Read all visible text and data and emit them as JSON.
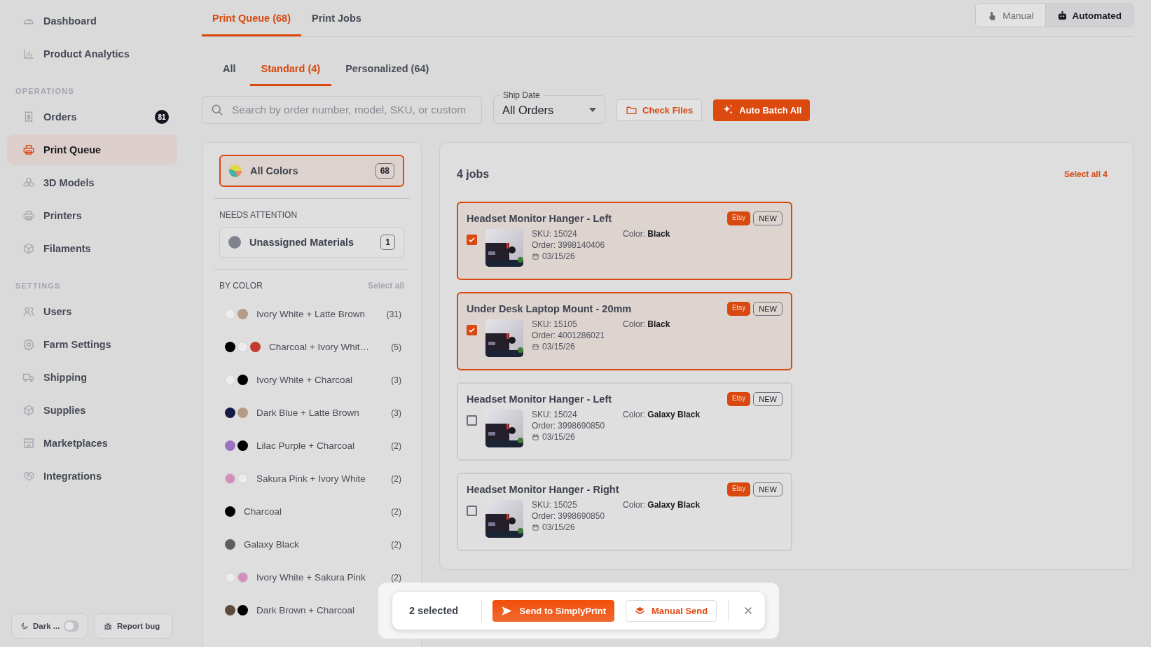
{
  "sidebar": {
    "sections": [
      {
        "items": [
          {
            "label": "Dashboard",
            "selected": false
          },
          {
            "label": "Product Analytics",
            "selected": false
          }
        ]
      },
      {
        "title": "OPERATIONS",
        "items": [
          {
            "label": "Orders",
            "selected": false,
            "badge": "81"
          },
          {
            "label": "Print Queue",
            "selected": true
          },
          {
            "label": "3D Models",
            "selected": false
          },
          {
            "label": "Printers",
            "selected": false
          },
          {
            "label": "Filaments",
            "selected": false
          }
        ]
      },
      {
        "title": "SETTINGS",
        "items": [
          {
            "label": "Users",
            "selected": false
          },
          {
            "label": "Farm Settings",
            "selected": false
          },
          {
            "label": "Shipping",
            "selected": false
          },
          {
            "label": "Supplies",
            "selected": false
          },
          {
            "label": "Marketplaces",
            "selected": false
          },
          {
            "label": "Integrations",
            "selected": false
          }
        ]
      }
    ],
    "dark_mode": {
      "label": "Dark ...",
      "on": false
    },
    "report_bug": "Report bug"
  },
  "tabs": [
    {
      "label": "Print Queue (68)",
      "selected": true
    },
    {
      "label": "Print Jobs",
      "selected": false
    }
  ],
  "mode_switch": [
    {
      "label": "Manual",
      "selected": false
    },
    {
      "label": "Automated",
      "selected": true
    }
  ],
  "subtabs": [
    {
      "label": "All",
      "selected": false
    },
    {
      "label": "Standard (4)",
      "selected": true
    },
    {
      "label": "Personalized (64)",
      "selected": false
    }
  ],
  "filters": {
    "search": {
      "placeholder": "Search by order number, model, SKU, or custom"
    },
    "ship_date": {
      "label": "Ship Date",
      "value": "All Orders"
    },
    "check_files": "Check Files",
    "auto_batch": "Auto Batch All"
  },
  "color_panel": {
    "all_colors": {
      "label": "All Colors",
      "count": "68",
      "selected": true
    },
    "needs_attention": {
      "title": "NEEDS ATTENTION",
      "items": [
        {
          "label": "Unassigned Materials",
          "count": "1",
          "selected": false
        }
      ]
    },
    "by_color": {
      "title": "BY COLOR",
      "select_all": "Select all",
      "items": [
        {
          "label": "Ivory White + Latte Brown",
          "count": "(31)",
          "swatches": [
            {
              "color": "#ececec"
            },
            {
              "color": "#b59c87"
            }
          ]
        },
        {
          "label": "Charcoal + Ivory Whit…",
          "count": "(5)",
          "swatches": [
            {
              "color": "#000000"
            },
            {
              "color": "#ececec"
            },
            {
              "color": "#c23a30"
            }
          ]
        },
        {
          "label": "Ivory White + Charcoal",
          "count": "(3)",
          "swatches": [
            {
              "color": "#ececec"
            },
            {
              "color": "#000000"
            }
          ]
        },
        {
          "label": "Dark Blue + Latte Brown",
          "count": "(3)",
          "swatches": [
            {
              "color": "#141b45"
            },
            {
              "color": "#b59c87"
            }
          ]
        },
        {
          "label": "Lilac Purple + Charcoal",
          "count": "(2)",
          "swatches": [
            {
              "color": "#9a72c4"
            },
            {
              "color": "#000000"
            }
          ]
        },
        {
          "label": "Sakura Pink + Ivory White",
          "count": "(2)",
          "swatches": [
            {
              "color": "#d28fba"
            },
            {
              "color": "#ececec"
            }
          ]
        },
        {
          "label": "Charcoal",
          "count": "(2)",
          "swatches": [
            {
              "color": "#000000"
            }
          ]
        },
        {
          "label": "Galaxy Black",
          "count": "(2)",
          "swatches": [
            {
              "color": "#5e5e5e"
            }
          ]
        },
        {
          "label": "Ivory White + Sakura Pink",
          "count": "(2)",
          "swatches": [
            {
              "color": "#ececec"
            },
            {
              "color": "#d28fba"
            }
          ]
        },
        {
          "label": "Dark Brown + Charcoal",
          "swatches": [
            {
              "color": "#5e4a3c"
            },
            {
              "color": "#000000"
            }
          ]
        }
      ]
    }
  },
  "jobs": {
    "count": "4 jobs",
    "select_all": "Select all 4",
    "items": [
      {
        "title": "Headset Monitor Hanger - Left",
        "checked": true,
        "sku": "SKU: 15024",
        "order": "Order: 3998140406",
        "date": "03/15/26",
        "finish": "Color: **Black**",
        "badges": [
          {
            "kind": "marketplace",
            "label": "Etsy"
          },
          {
            "kind": "status",
            "label": "NEW"
          }
        ]
      },
      {
        "title": "Under Desk Laptop Mount - 20mm",
        "checked": true,
        "sku": "SKU: 15105",
        "order": "Order: 4001286021",
        "date": "03/15/26",
        "finish": "Color: **Black**",
        "badges": [
          {
            "kind": "marketplace",
            "label": "Etsy"
          },
          {
            "kind": "status",
            "label": "NEW"
          }
        ]
      },
      {
        "title": "Headset Monitor Hanger - Left",
        "checked": false,
        "sku": "SKU: 15024",
        "order": "Order: 3998690850",
        "date": "03/15/26",
        "finish": "Color: **Galaxy Black**",
        "badges": [
          {
            "kind": "marketplace",
            "label": "Etsy"
          },
          {
            "kind": "status",
            "label": "NEW"
          }
        ]
      },
      {
        "title": "Headset Monitor Hanger - Right",
        "checked": false,
        "sku": "SKU: 15025",
        "order": "Order: 3998690850",
        "date": "03/15/26",
        "finish": "Color: **Galaxy Black**",
        "badges": [
          {
            "kind": "marketplace",
            "label": "Etsy"
          },
          {
            "kind": "status",
            "label": "NEW"
          }
        ]
      }
    ]
  },
  "action_bar": {
    "selected": "2 selected",
    "send": "Send to SimplyPrint",
    "manual": "Manual Send"
  }
}
